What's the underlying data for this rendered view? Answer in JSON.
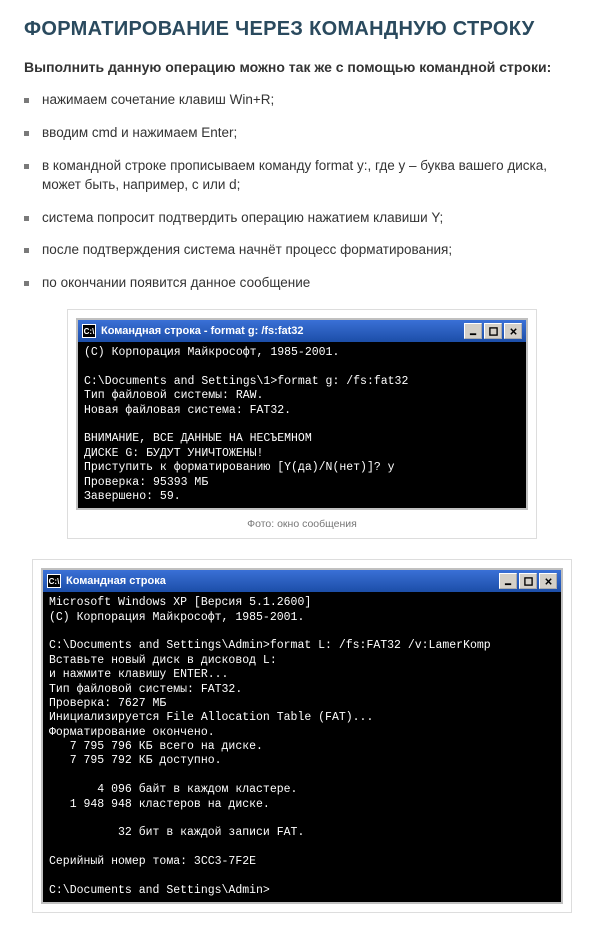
{
  "heading": "ФОРМАТИРОВАНИЕ ЧЕРЕЗ КОМАНДНУЮ СТРОКУ",
  "intro": "Выполнить данную операцию можно так же с помощью командной строки:",
  "steps": [
    "нажимаем сочетание клавиш Win+R;",
    "вводим cmd и нажимаем Enter;",
    "в командной строке прописываем команду format y:, где y – буква вашего диска, может быть, например, c или d;",
    "система попросит подтвердить операцию нажатием клавиши Y;",
    "после подтверждения система начнёт процесс форматирования;",
    "по окончании появится данное сообщение"
  ],
  "figure1": {
    "title": "Командная строка - format g: /fs:fat32",
    "icon": "C:\\",
    "body": "(С) Корпорация Майкрософт, 1985-2001.\n\nC:\\Documents and Settings\\1>format g: /fs:fat32\nТип файловой системы: RAW.\nНовая файловая система: FAT32.\n\nВНИМАНИЕ, ВСЕ ДАННЫЕ НА НЕСЪЕМНОМ\nДИСКЕ G: БУДУТ УНИЧТОЖЕНЫ!\nПриступить к форматированию [Y(да)/N(нет)]? y\nПроверка: 95393 МБ\nЗавершено: 59.",
    "caption": "Фото: окно сообщения"
  },
  "figure2": {
    "title": "Командная строка",
    "icon": "C:\\",
    "body": "Microsoft Windows XP [Версия 5.1.2600]\n(С) Корпорация Майкрософт, 1985-2001.\n\nC:\\Documents and Settings\\Admin>format L: /fs:FAT32 /v:LamerKomp\nВставьте новый диск в дисковод L:\nи нажмите клавишу ENTER...\nТип файловой системы: FAT32.\nПроверка: 7627 МБ\nИнициализируется File Allocation Table (FAT)...\nФорматирование окончено.\n   7 795 796 КБ всего на диске.\n   7 795 792 КБ доступно.\n\n       4 096 байт в каждом кластере.\n   1 948 948 кластеров на диске.\n\n          32 бит в каждой записи FAT.\n\nСерийный номер тома: 3CC3-7F2E\n\nC:\\Documents and Settings\\Admin>"
  }
}
